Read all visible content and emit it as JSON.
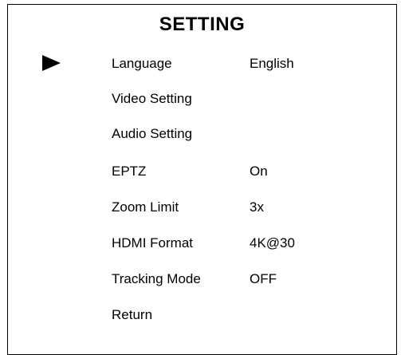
{
  "menu": {
    "title": "SETTING",
    "cursor_icon": "right-pointing-triangle",
    "selected_index": 0,
    "items": [
      {
        "label": "Language",
        "value": "English"
      },
      {
        "label": "Video Setting",
        "value": ""
      },
      {
        "label": "Audio Setting",
        "value": ""
      },
      {
        "label": "EPTZ",
        "value": "On"
      },
      {
        "label": "Zoom Limit",
        "value": "3x"
      },
      {
        "label": "HDMI Format",
        "value": "4K@30"
      },
      {
        "label": "Tracking Mode",
        "value": "OFF"
      },
      {
        "label": "Return",
        "value": ""
      }
    ]
  }
}
